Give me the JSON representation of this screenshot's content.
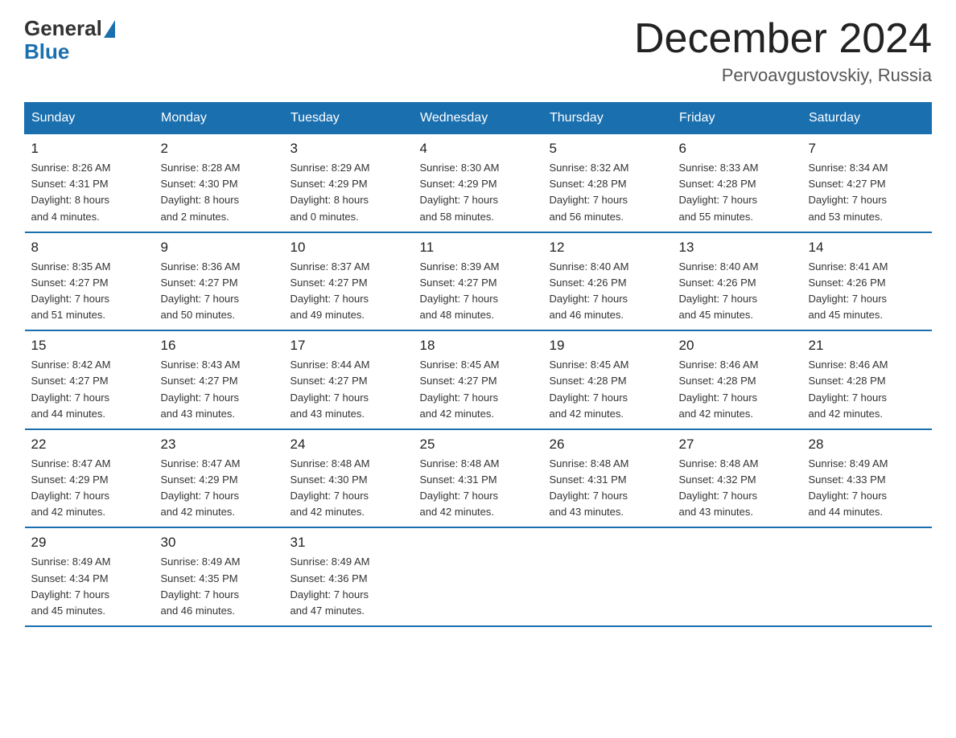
{
  "header": {
    "logo_general": "General",
    "logo_blue": "Blue",
    "title": "December 2024",
    "subtitle": "Pervoavgustovskiy, Russia"
  },
  "days_of_week": [
    "Sunday",
    "Monday",
    "Tuesday",
    "Wednesday",
    "Thursday",
    "Friday",
    "Saturday"
  ],
  "weeks": [
    [
      {
        "day": "1",
        "sunrise": "8:26 AM",
        "sunset": "4:31 PM",
        "daylight": "8 hours and 4 minutes."
      },
      {
        "day": "2",
        "sunrise": "8:28 AM",
        "sunset": "4:30 PM",
        "daylight": "8 hours and 2 minutes."
      },
      {
        "day": "3",
        "sunrise": "8:29 AM",
        "sunset": "4:29 PM",
        "daylight": "8 hours and 0 minutes."
      },
      {
        "day": "4",
        "sunrise": "8:30 AM",
        "sunset": "4:29 PM",
        "daylight": "7 hours and 58 minutes."
      },
      {
        "day": "5",
        "sunrise": "8:32 AM",
        "sunset": "4:28 PM",
        "daylight": "7 hours and 56 minutes."
      },
      {
        "day": "6",
        "sunrise": "8:33 AM",
        "sunset": "4:28 PM",
        "daylight": "7 hours and 55 minutes."
      },
      {
        "day": "7",
        "sunrise": "8:34 AM",
        "sunset": "4:27 PM",
        "daylight": "7 hours and 53 minutes."
      }
    ],
    [
      {
        "day": "8",
        "sunrise": "8:35 AM",
        "sunset": "4:27 PM",
        "daylight": "7 hours and 51 minutes."
      },
      {
        "day": "9",
        "sunrise": "8:36 AM",
        "sunset": "4:27 PM",
        "daylight": "7 hours and 50 minutes."
      },
      {
        "day": "10",
        "sunrise": "8:37 AM",
        "sunset": "4:27 PM",
        "daylight": "7 hours and 49 minutes."
      },
      {
        "day": "11",
        "sunrise": "8:39 AM",
        "sunset": "4:27 PM",
        "daylight": "7 hours and 48 minutes."
      },
      {
        "day": "12",
        "sunrise": "8:40 AM",
        "sunset": "4:26 PM",
        "daylight": "7 hours and 46 minutes."
      },
      {
        "day": "13",
        "sunrise": "8:40 AM",
        "sunset": "4:26 PM",
        "daylight": "7 hours and 45 minutes."
      },
      {
        "day": "14",
        "sunrise": "8:41 AM",
        "sunset": "4:26 PM",
        "daylight": "7 hours and 45 minutes."
      }
    ],
    [
      {
        "day": "15",
        "sunrise": "8:42 AM",
        "sunset": "4:27 PM",
        "daylight": "7 hours and 44 minutes."
      },
      {
        "day": "16",
        "sunrise": "8:43 AM",
        "sunset": "4:27 PM",
        "daylight": "7 hours and 43 minutes."
      },
      {
        "day": "17",
        "sunrise": "8:44 AM",
        "sunset": "4:27 PM",
        "daylight": "7 hours and 43 minutes."
      },
      {
        "day": "18",
        "sunrise": "8:45 AM",
        "sunset": "4:27 PM",
        "daylight": "7 hours and 42 minutes."
      },
      {
        "day": "19",
        "sunrise": "8:45 AM",
        "sunset": "4:28 PM",
        "daylight": "7 hours and 42 minutes."
      },
      {
        "day": "20",
        "sunrise": "8:46 AM",
        "sunset": "4:28 PM",
        "daylight": "7 hours and 42 minutes."
      },
      {
        "day": "21",
        "sunrise": "8:46 AM",
        "sunset": "4:28 PM",
        "daylight": "7 hours and 42 minutes."
      }
    ],
    [
      {
        "day": "22",
        "sunrise": "8:47 AM",
        "sunset": "4:29 PM",
        "daylight": "7 hours and 42 minutes."
      },
      {
        "day": "23",
        "sunrise": "8:47 AM",
        "sunset": "4:29 PM",
        "daylight": "7 hours and 42 minutes."
      },
      {
        "day": "24",
        "sunrise": "8:48 AM",
        "sunset": "4:30 PM",
        "daylight": "7 hours and 42 minutes."
      },
      {
        "day": "25",
        "sunrise": "8:48 AM",
        "sunset": "4:31 PM",
        "daylight": "7 hours and 42 minutes."
      },
      {
        "day": "26",
        "sunrise": "8:48 AM",
        "sunset": "4:31 PM",
        "daylight": "7 hours and 43 minutes."
      },
      {
        "day": "27",
        "sunrise": "8:48 AM",
        "sunset": "4:32 PM",
        "daylight": "7 hours and 43 minutes."
      },
      {
        "day": "28",
        "sunrise": "8:49 AM",
        "sunset": "4:33 PM",
        "daylight": "7 hours and 44 minutes."
      }
    ],
    [
      {
        "day": "29",
        "sunrise": "8:49 AM",
        "sunset": "4:34 PM",
        "daylight": "7 hours and 45 minutes."
      },
      {
        "day": "30",
        "sunrise": "8:49 AM",
        "sunset": "4:35 PM",
        "daylight": "7 hours and 46 minutes."
      },
      {
        "day": "31",
        "sunrise": "8:49 AM",
        "sunset": "4:36 PM",
        "daylight": "7 hours and 47 minutes."
      },
      null,
      null,
      null,
      null
    ]
  ],
  "labels": {
    "sunrise": "Sunrise:",
    "sunset": "Sunset:",
    "daylight": "Daylight:"
  }
}
